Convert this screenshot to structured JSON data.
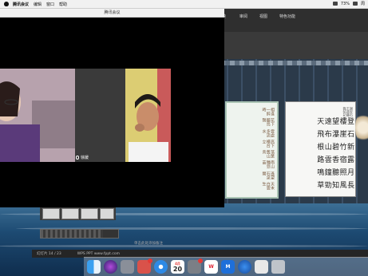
{
  "menubar": {
    "app_name": "腾讯会议",
    "items": [
      "编辑",
      "窗口",
      "帮助"
    ],
    "status": {
      "battery": "73%",
      "clock": "周"
    }
  },
  "meeting": {
    "window_title": "腾讯会议",
    "participant_label": "徐媛"
  },
  "ppt": {
    "tabs": [
      "动画",
      "放映",
      "审阅",
      "视图",
      "特色功能"
    ],
    "status_left": "幻灯片 14 / 23",
    "status_theme": "WPS PPT  www.fppt.com",
    "note_label": "单击此处添加备注",
    "progress": 0.8
  },
  "calligraphy": {
    "slide_a_cols": [
      "天末白雲生",
      "遙望石泉開",
      "南山種豆苗",
      "落葉舊山青",
      "高下樓台立",
      "雲處多流水",
      "花下聽鳥聲",
      "相逢一醉時"
    ],
    "slide_b_title": "謝安石王道蘊臨帖記",
    "slide_b_cols": [
      "長風知勁草",
      "月照聽鐘鳴",
      "露宿香雲路",
      "新竹碧山根",
      "石崖瀑布飛",
      "登樓望遠天"
    ]
  },
  "dock": {
    "calendar_month": "4月",
    "calendar_day": "20",
    "apps": [
      "finder-icon",
      "siri-icon",
      "launchpad-icon",
      "safari-icon",
      "calendar-icon",
      "settings-icon",
      "wps-icon",
      "tencent-meeting-icon",
      "browser-icon",
      "trash-icon"
    ]
  },
  "colors": {
    "desktop": "#1b3550",
    "accent": "#e53935"
  }
}
